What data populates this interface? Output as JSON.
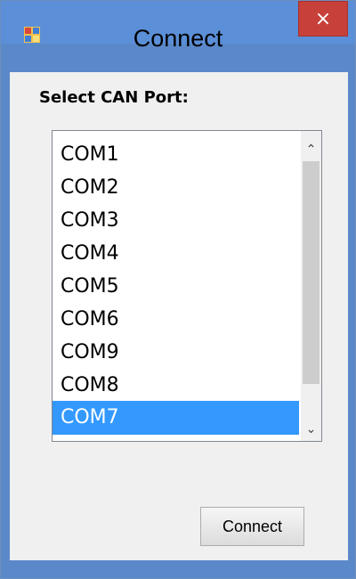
{
  "window": {
    "title": "Connect",
    "close_glyph": "×",
    "app_icon": "windows-form-icon",
    "colors": {
      "titlebar": "#5b8fd8",
      "close": "#c7403a",
      "selection": "#3399ff"
    }
  },
  "form": {
    "label": "Select CAN Port:",
    "ports": [
      {
        "label": "COM1",
        "selected": false
      },
      {
        "label": "COM2",
        "selected": false
      },
      {
        "label": "COM3",
        "selected": false
      },
      {
        "label": "COM4",
        "selected": false
      },
      {
        "label": "COM5",
        "selected": false
      },
      {
        "label": "COM6",
        "selected": false
      },
      {
        "label": "COM9",
        "selected": false
      },
      {
        "label": "COM8",
        "selected": false
      },
      {
        "label": "COM7",
        "selected": true
      }
    ],
    "scroll_up_glyph": "⌃",
    "scroll_down_glyph": "⌄",
    "connect_label": "Connect"
  }
}
